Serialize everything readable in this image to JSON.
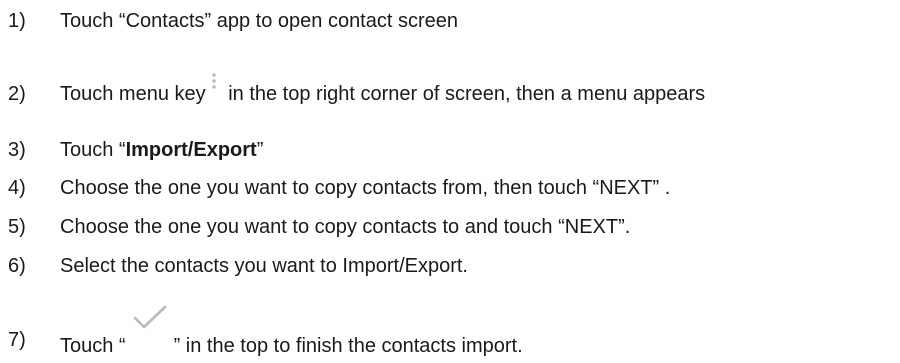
{
  "steps": [
    {
      "num": "1)",
      "text": "Touch “Contacts” app to open contact screen"
    },
    {
      "num": "2)",
      "text_before": "Touch menu key",
      "text_after": " in the top right corner of screen, then a menu appears",
      "icon": "vertical-dots-menu-icon"
    },
    {
      "num": "3)",
      "text_before": "Touch “",
      "bold": "Import/Export",
      "text_after": "”"
    },
    {
      "num": "4)",
      "text_before": "Choose the one you want to copy contacts from, then touch ",
      "quoted": "“NEXT”",
      "text_after": " ."
    },
    {
      "num": "5)",
      "text": "Choose the one you want to copy contacts to and touch “NEXT”."
    },
    {
      "num": "6)",
      "text": "Select the contacts you want to Import/Export."
    },
    {
      "num": "7)",
      "text_before": "Touch “",
      "text_after": "” in the top to finish the contacts import.",
      "icon": "checkmark-icon"
    }
  ],
  "colors": {
    "text": "#1a1a1a",
    "icon": "#b9b9b9"
  }
}
